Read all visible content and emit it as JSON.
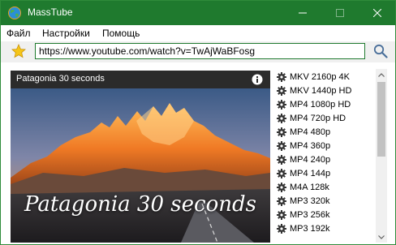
{
  "window": {
    "title": "MassTube",
    "accent_color": "#1f7a2e"
  },
  "titlebar_icons": [
    "globe-icon",
    "minimize-icon",
    "maximize-icon",
    "close-icon"
  ],
  "menu": {
    "items": [
      "Файл",
      "Настройки",
      "Помощь"
    ]
  },
  "toolbar": {
    "favorite_icon": "star-icon",
    "url_value": "https://www.youtube.com/watch?v=TwAjWaBFosg",
    "search_icon": "magnifier-icon"
  },
  "video": {
    "title": "Patagonia 30 seconds",
    "caption": "Patagonia 30 seconds",
    "info_icon": "info-icon"
  },
  "formats": [
    "MKV 2160p 4K",
    "MKV 1440p HD",
    "MP4 1080p HD",
    "MP4 720p HD",
    "MP4 480p",
    "MP4 360p",
    "MP4 240p",
    "MP4 144p",
    "M4A 128k",
    "MP3 320k",
    "MP3 256k",
    "MP3 192k"
  ]
}
